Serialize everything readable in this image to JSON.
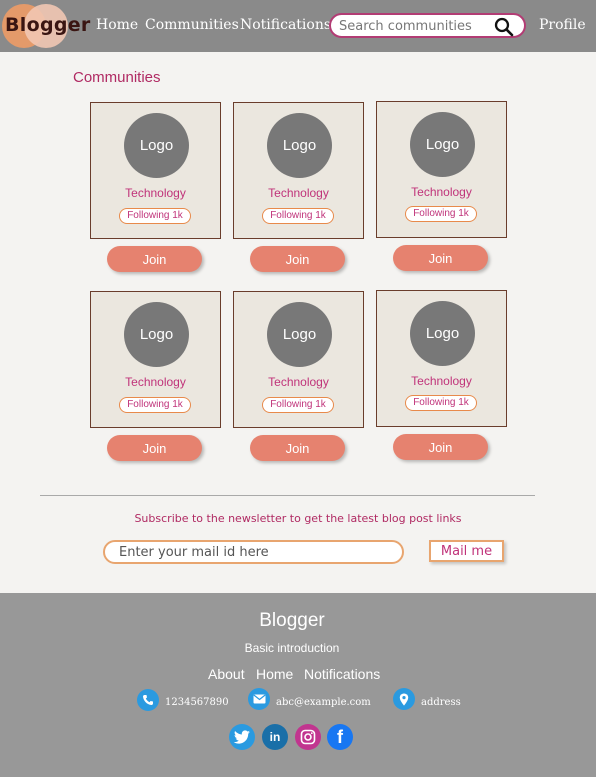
{
  "brand": "Blogger",
  "nav": {
    "home": "Home",
    "communities": "Communities",
    "notifications": "Notifications",
    "profile": "Profile"
  },
  "search": {
    "placeholder": "Search communities"
  },
  "section_title": "Communities",
  "cards": [
    {
      "logo": "Logo",
      "title": "Technology",
      "following": "Following 1k",
      "join": "Join"
    },
    {
      "logo": "Logo",
      "title": "Technology",
      "following": "Following 1k",
      "join": "Join"
    },
    {
      "logo": "Logo",
      "title": "Technology",
      "following": "Following 1k",
      "join": "Join"
    },
    {
      "logo": "Logo",
      "title": "Technology",
      "following": "Following 1k",
      "join": "Join"
    },
    {
      "logo": "Logo",
      "title": "Technology",
      "following": "Following 1k",
      "join": "Join"
    },
    {
      "logo": "Logo",
      "title": "Technology",
      "following": "Following 1k",
      "join": "Join"
    }
  ],
  "newsletter": {
    "text": "Subscribe to the newsletter to get the latest blog post links",
    "placeholder": "Enter your mail id here",
    "button": "Mail me"
  },
  "footer": {
    "brand": "Blogger",
    "intro": "Basic introduction",
    "links": [
      "About",
      "Home",
      "Notifications"
    ],
    "phone": "1234567890",
    "email": "abc@example.com",
    "address": "address",
    "social": [
      "twitter-icon",
      "linkedin-icon",
      "instagram-icon",
      "facebook-icon"
    ]
  },
  "colors": {
    "nav_bg": "#8a8a8a",
    "accent": "#b02a63",
    "join_btn": "#e6826f",
    "footer_bg": "#989898"
  }
}
